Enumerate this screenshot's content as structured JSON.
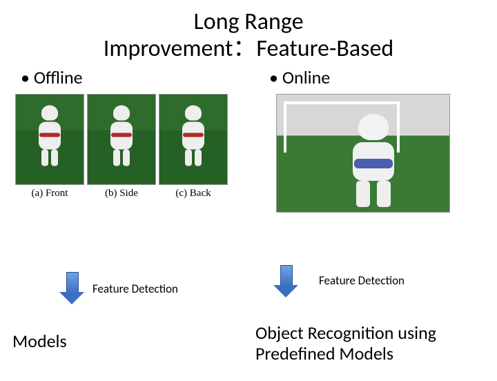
{
  "title_line1": "Long Range",
  "title_line2": "Improvement：Feature-Based",
  "left": {
    "heading": "Offline",
    "captions": {
      "a": "(a) Front",
      "b": "(b) Side",
      "c": "(c) Back"
    },
    "arrow_label": "Feature Detection",
    "result": "Models"
  },
  "right": {
    "heading": "Online",
    "arrow_label": "Feature Detection",
    "result_line1": "Object Recognition using",
    "result_line2": "Predefined Models"
  }
}
